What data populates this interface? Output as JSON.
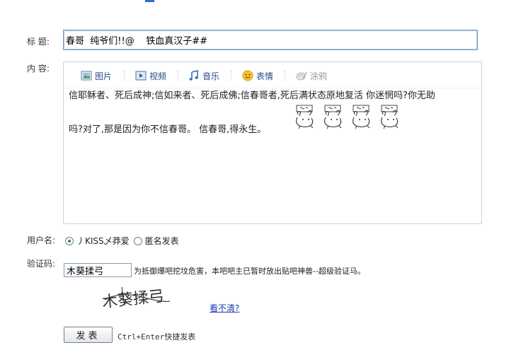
{
  "form": {
    "title_label": "标  题:",
    "title_value": "春哥  纯爷们!!@    铁血真汉子##",
    "content_label": "内  容:"
  },
  "toolbar": {
    "picture": "图片",
    "video": "视频",
    "music": "音乐",
    "emoticon": "表情",
    "doodle": "涂鸦"
  },
  "editor": {
    "line1": "信耶稣者、死后成神;信如来者、死后成佛;信春哥者,死后满状态原地复活  你迷惘吗?你无助",
    "line2": "吗?对了,那是因为你不信春哥。   信春哥,得永生。",
    "emoticons": [
      "rabbit-emoticon",
      "rabbit-emoticon",
      "rabbit-emoticon",
      "rabbit-emoticon"
    ]
  },
  "user": {
    "label": "用户名:",
    "option_named": "丿KISS乄莽爱",
    "option_anon": "匿名发表",
    "selected": "named"
  },
  "captcha": {
    "label": "验证码:",
    "input_value": "木葵揉弓",
    "hint": "为抵御爆吧挖坟危害，本吧吧主已暂时放出贴吧神兽--超级验证马。",
    "image_text": "木葵揉弓",
    "refresh_link": "看不清?"
  },
  "submit": {
    "button_label": "发表",
    "shortcut_key": "Ctrl+Enter",
    "shortcut_text": "快捷发表"
  },
  "colors": {
    "link": "#1a3fae",
    "input_border": "#7f9db9",
    "toolbar_text": "#2a4a8a"
  }
}
